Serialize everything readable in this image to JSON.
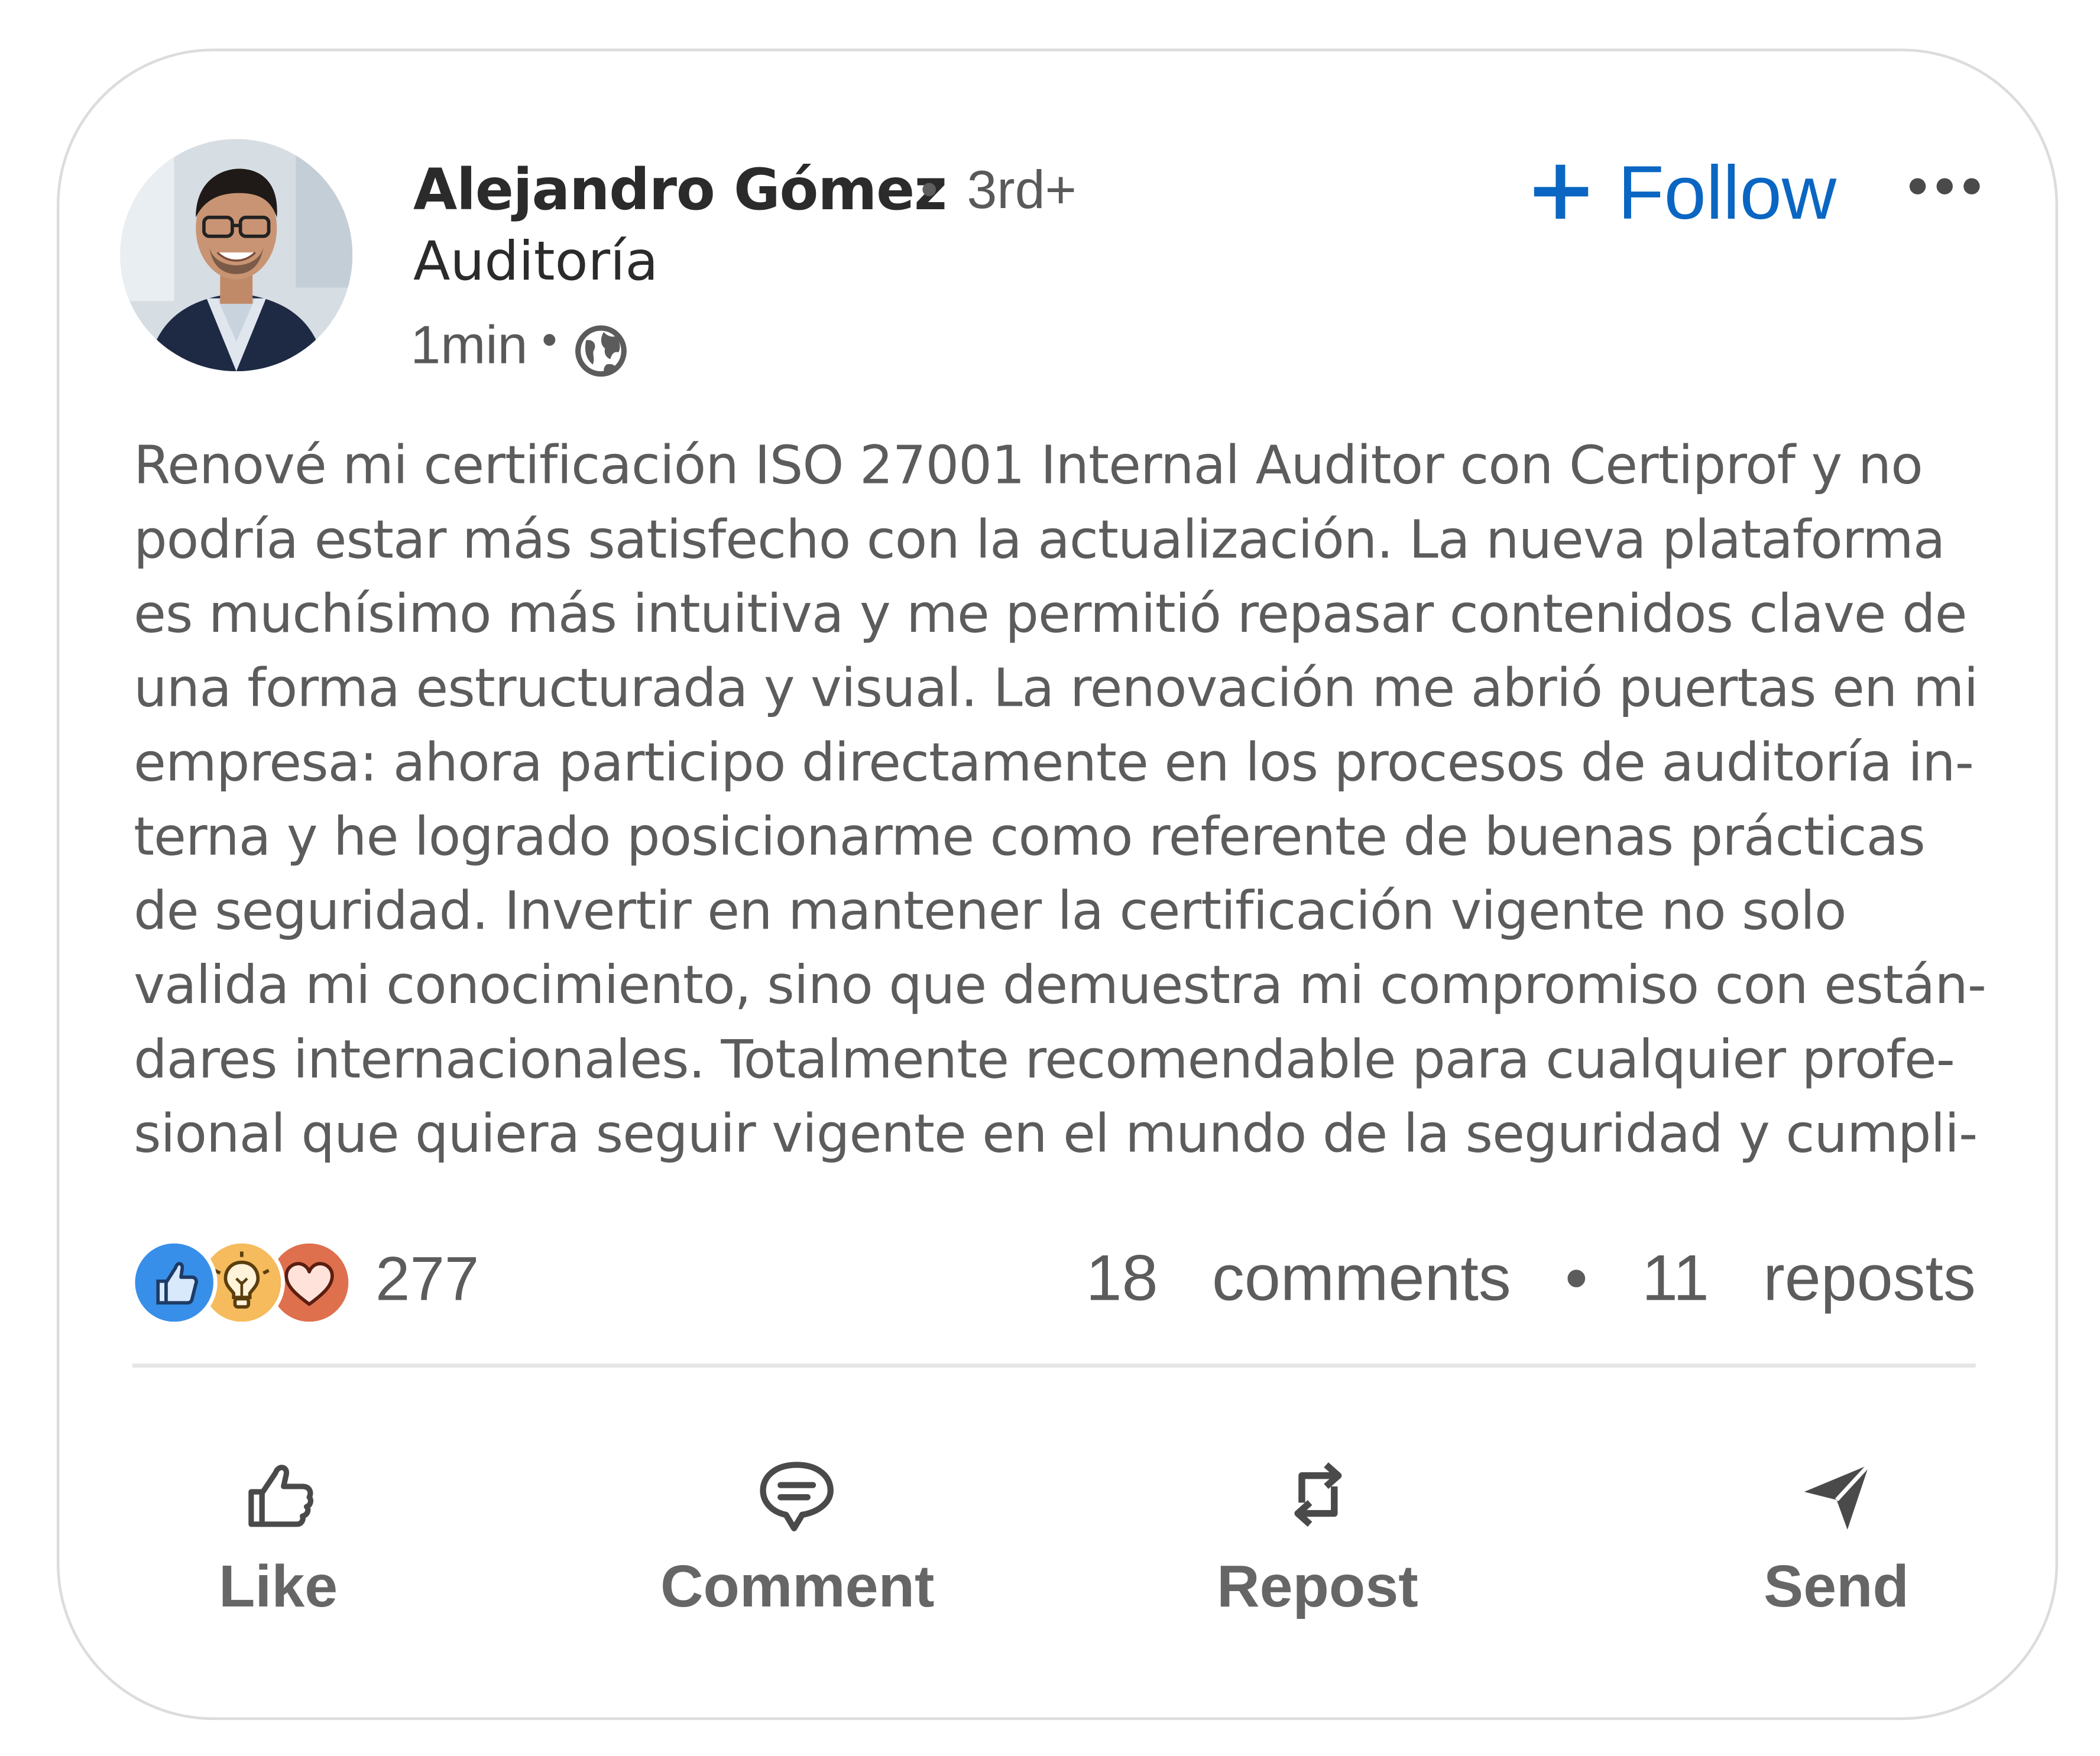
{
  "post": {
    "author": {
      "name": "Alejandro Gómez",
      "separator": "•",
      "degree": "3rd+",
      "headline": "Auditoría"
    },
    "meta": {
      "time": "1min",
      "separator": "•",
      "visibility_icon": "globe-icon"
    },
    "follow_plus": "+",
    "follow_label": "Follow",
    "more_icon": "more-dots-icon",
    "body_lines": [
      "Renové mi certificación ISO 27001 Internal Auditor con Certiprof y no",
      "podría estar más satisfecho con la actualización. La nueva plataforma",
      "es muchísimo más intuitiva y me permitió repasar contenidos clave de",
      "una forma estructurada y visual. La renovación me abrió puertas en mi",
      "empresa: ahora participo directamente en los procesos de auditoría in-",
      "terna y he logrado posicionarme como referente de buenas prácticas",
      "de seguridad. Invertir en mantener la certificación vigente no solo",
      "valida mi conocimiento, sino que demuestra mi compromiso con están-",
      "dares internacionales. Totalmente recomendable para cualquier profe-",
      "sional que quiera seguir vigente en el mundo de la seguridad y cumpli-"
    ]
  },
  "social": {
    "reaction_icons": [
      "like-reaction-icon",
      "insightful-reaction-icon",
      "love-reaction-icon"
    ],
    "reaction_count": "277",
    "comments_count": "18",
    "comments_label": "comments",
    "separator": "•",
    "reposts_count": "11",
    "reposts_label": "reposts"
  },
  "actions": [
    {
      "label": "Like",
      "icon": "thumbs-up-icon"
    },
    {
      "label": "Comment",
      "icon": "comment-icon"
    },
    {
      "label": "Repost",
      "icon": "repost-icon"
    },
    {
      "label": "Send",
      "icon": "send-icon"
    }
  ],
  "colors": {
    "accent": "#0a66c2",
    "text_primary": "#2b2b2b",
    "text_secondary": "#5c5c5c",
    "like_reaction": "#378fe9",
    "insightful_reaction": "#f5bb5c",
    "love_reaction": "#df704d"
  }
}
